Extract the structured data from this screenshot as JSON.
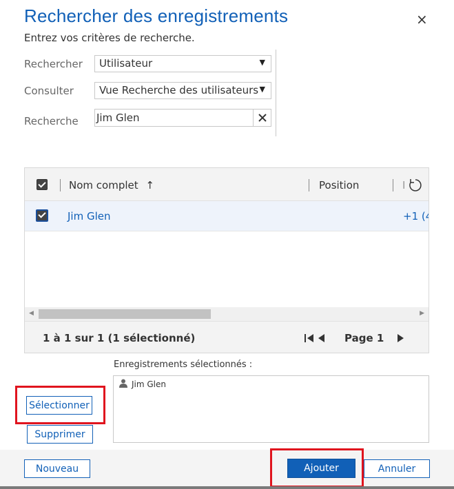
{
  "dialog": {
    "title": "Rechercher des enregistrements",
    "subtitle": "Entrez vos critères de recherche.",
    "close_label": "×"
  },
  "form": {
    "look_for_label": "Rechercher",
    "look_for_value": "Utilisateur",
    "view_label": "Consulter",
    "view_value": "Vue Recherche des utilisateurs",
    "search_label": "Recherche",
    "search_value": "Jim Glen"
  },
  "grid": {
    "columns": [
      "Nom complet",
      "Position",
      "I"
    ],
    "sort_icon": "↑",
    "rows": [
      {
        "full_name": "Jim Glen",
        "phone": "+1 (4"
      }
    ],
    "status": "1 à 1 sur 1 (1 sélectionné)",
    "page_label": "Page 1"
  },
  "selected": {
    "label": "Enregistrements sélectionnés :",
    "items": [
      "Jim Glen"
    ]
  },
  "buttons": {
    "select": "Sélectionner",
    "remove": "Supprimer",
    "new": "Nouveau",
    "add": "Ajouter",
    "cancel": "Annuler"
  },
  "colors": {
    "accent": "#1160b7",
    "highlight": "#e0141e"
  }
}
